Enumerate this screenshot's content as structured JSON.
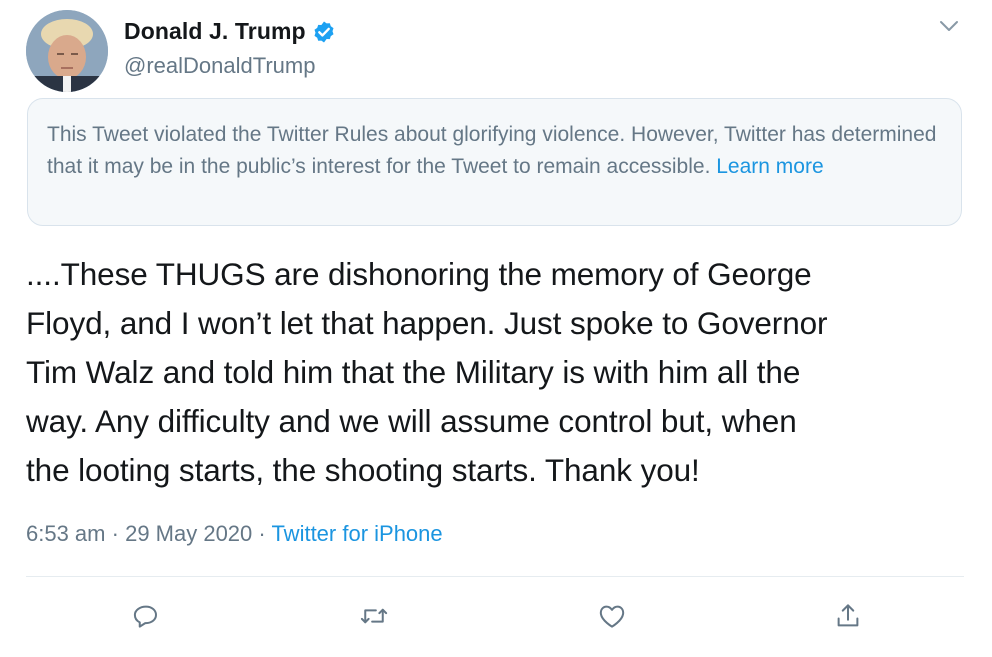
{
  "tweet": {
    "display_name": "Donald J. Trump",
    "handle": "@realDonaldTrump",
    "verified_icon": "verified-badge-icon",
    "menu_icon": "chevron-down-icon",
    "notice": {
      "text": "This Tweet violated the Twitter Rules about glorifying violence. However, Twitter has determined that it may be in the public’s interest for the Tweet to remain accessible.",
      "link_label": "Learn more"
    },
    "text_lines": [
      "....These THUGS are dishonoring the memory of George",
      "Floyd, and I won’t let that happen. Just spoke to Governor",
      "Tim Walz and told him that the Military is with him all the",
      "way. Any difficulty and we will assume control but, when",
      "the looting starts, the shooting starts. Thank you!"
    ],
    "time": "6:53 am",
    "date": "29 May 2020",
    "separator": "·",
    "source": "Twitter for iPhone",
    "actions": [
      "reply-icon",
      "retweet-icon",
      "like-icon",
      "share-icon"
    ]
  },
  "colors": {
    "accent": "#1b95e0",
    "secondary_text": "#657786",
    "notice_bg": "#f5f8fa"
  }
}
